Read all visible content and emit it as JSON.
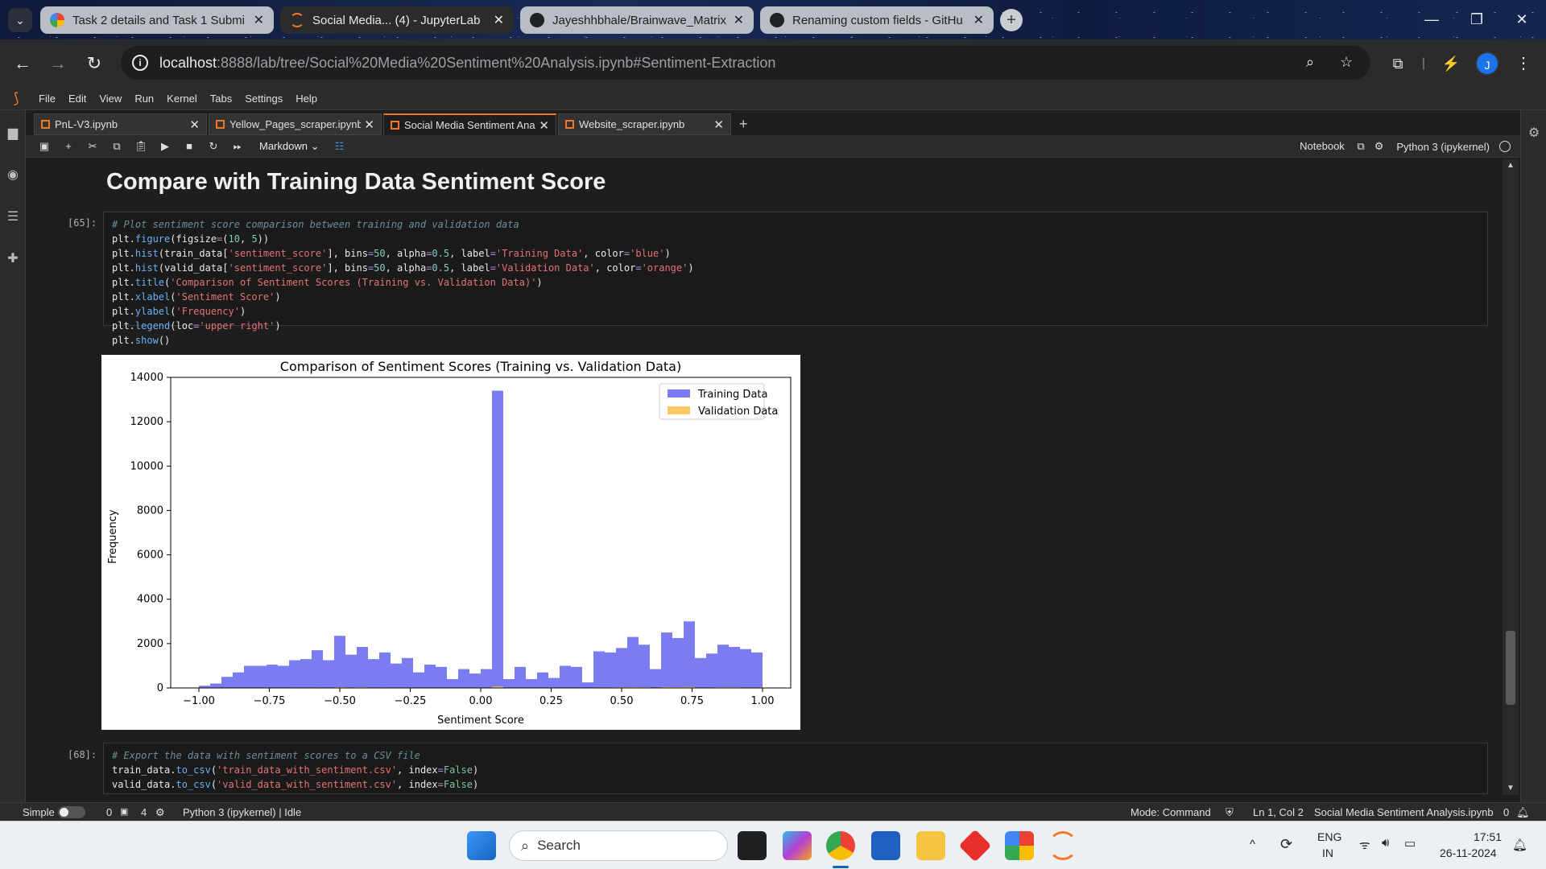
{
  "browser": {
    "tabs": [
      {
        "title": "Task 2 details and Task 1 Submi",
        "icon": "gmail-icon",
        "active": false
      },
      {
        "title": "Social Media... (4) - JupyterLab",
        "icon": "jupyter-icon",
        "active": true
      },
      {
        "title": "Jayeshhbhale/Brainwave_Matrix",
        "icon": "github-icon",
        "active": false
      },
      {
        "title": "Renaming custom fields - GitHu",
        "icon": "github-icon",
        "active": false
      }
    ],
    "url_host": "localhost",
    "url_path": ":8888/lab/tree/Social%20Media%20Sentiment%20Analysis.ipynb#Sentiment-Extraction",
    "avatar_letter": "J"
  },
  "jupyter": {
    "menu": [
      "File",
      "Edit",
      "View",
      "Run",
      "Kernel",
      "Tabs",
      "Settings",
      "Help"
    ],
    "doc_tabs": [
      {
        "title": "PnL-V3.ipynb",
        "active": false
      },
      {
        "title": "Yellow_Pages_scraper.ipynb",
        "active": false
      },
      {
        "title": "Social Media Sentiment Anal",
        "active": true
      },
      {
        "title": "Website_scraper.ipynb",
        "active": false
      }
    ],
    "cell_type": "Markdown",
    "notebook_label": "Notebook",
    "kernel_label": "Python 3 (ipykernel)"
  },
  "notebook": {
    "heading": "Compare with Training Data Sentiment Score",
    "cell1": {
      "prompt": "[65]:",
      "lines": [
        "# Plot sentiment score comparison between training and validation data",
        "plt.figure(figsize=(10, 5))",
        "plt.hist(train_data['sentiment_score'], bins=50, alpha=0.5, label='Training Data', color='blue')",
        "plt.hist(valid_data['sentiment_score'], bins=50, alpha=0.5, label='Validation Data', color='orange')",
        "plt.title('Comparison of Sentiment Scores (Training vs. Validation Data)')",
        "plt.xlabel('Sentiment Score')",
        "plt.ylabel('Frequency')",
        "plt.legend(loc='upper right')",
        "plt.show()"
      ]
    },
    "cell2": {
      "prompt": "[68]:",
      "lines": [
        "# Export the data with sentiment scores to a CSV file",
        "train_data.to_csv('train_data_with_sentiment.csv', index=False)",
        "valid_data.to_csv('valid_data_with_sentiment.csv', index=False)"
      ]
    }
  },
  "chart_data": {
    "type": "bar",
    "title": "Comparison of Sentiment Scores (Training vs. Validation Data)",
    "xlabel": "Sentiment Score",
    "ylabel": "Frequency",
    "xlim": [
      -1.1,
      1.1
    ],
    "ylim": [
      0,
      14000
    ],
    "xticks": [
      "−1.00",
      "−0.75",
      "−0.50",
      "−0.25",
      "0.00",
      "0.25",
      "0.50",
      "0.75",
      "1.00"
    ],
    "xtick_values": [
      -1.0,
      -0.75,
      -0.5,
      -0.25,
      0.0,
      0.25,
      0.5,
      0.75,
      1.0
    ],
    "yticks": [
      "0",
      "2000",
      "4000",
      "6000",
      "8000",
      "10000",
      "12000",
      "14000"
    ],
    "ytick_values": [
      0,
      2000,
      4000,
      6000,
      8000,
      10000,
      12000,
      14000
    ],
    "legend_position": "upper right",
    "bin_start": -1.0,
    "bin_width": 0.04,
    "series": [
      {
        "name": "Training Data",
        "color": "#7b7bf2",
        "values": [
          100,
          200,
          500,
          700,
          1000,
          1000,
          1050,
          1000,
          1250,
          1300,
          1700,
          1250,
          2350,
          1500,
          1850,
          1300,
          1600,
          1100,
          1350,
          700,
          1050,
          950,
          400,
          850,
          650,
          850,
          13400,
          400,
          950,
          400,
          700,
          450,
          1000,
          950,
          250,
          1650,
          1600,
          1800,
          2300,
          1950,
          850,
          2500,
          2250,
          3000,
          1350,
          1550,
          1950,
          1850,
          1750,
          1600
        ]
      },
      {
        "name": "Validation Data",
        "color": "#ffc966",
        "values": [
          0,
          0,
          5,
          10,
          15,
          15,
          15,
          15,
          20,
          20,
          25,
          20,
          35,
          25,
          30,
          20,
          25,
          20,
          20,
          15,
          15,
          15,
          10,
          15,
          10,
          15,
          60,
          10,
          15,
          10,
          10,
          10,
          15,
          15,
          5,
          25,
          25,
          30,
          35,
          30,
          15,
          40,
          35,
          45,
          20,
          25,
          30,
          30,
          25,
          25
        ]
      }
    ]
  },
  "statusbar": {
    "mode_simple": "Simple",
    "terminals": "0",
    "kernels": "4",
    "kernel_status": "Python 3 (ipykernel) | Idle",
    "mode": "Mode: Command",
    "cursor": "Ln 1, Col 2",
    "filename": "Social Media Sentiment Analysis.ipynb",
    "notifications": "0"
  },
  "taskbar": {
    "search_placeholder": "Search",
    "lang_top": "ENG",
    "lang_bottom": "IN",
    "time": "17:51",
    "date": "26-11-2024"
  }
}
